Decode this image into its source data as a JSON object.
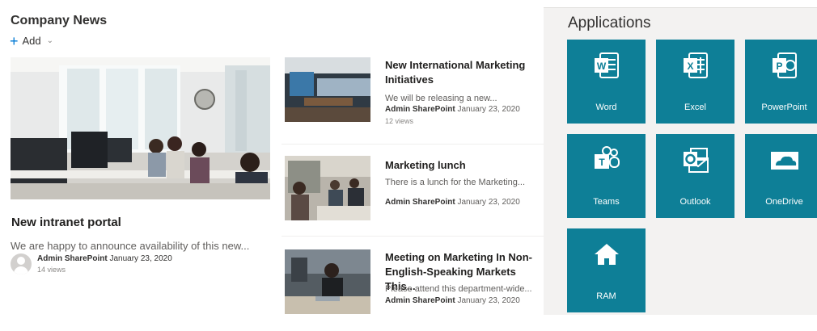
{
  "news": {
    "title": "Company News",
    "add_label": "Add",
    "hero": {
      "title": "New intranet portal",
      "description": "We are happy to announce availability of this new...",
      "author": "Admin SharePoint",
      "date": "January 23, 2020",
      "views": "14 views"
    },
    "items": [
      {
        "title": "New International Marketing Initiatives",
        "description": "We will be releasing a new...",
        "author": "Admin SharePoint",
        "date": "January 23, 2020",
        "views": "12 views"
      },
      {
        "title": "Marketing lunch",
        "description": "There is a lunch for the Marketing...",
        "author": "Admin SharePoint",
        "date": "January 23, 2020"
      },
      {
        "title": "Meeting on Marketing In Non-English-Speaking Markets This...",
        "description": "Please attend this department-wide...",
        "author": "Admin SharePoint",
        "date": "January 23, 2020"
      }
    ]
  },
  "apps": {
    "title": "Applications",
    "tiles": [
      {
        "label": "Word",
        "icon": "word-icon"
      },
      {
        "label": "Excel",
        "icon": "excel-icon"
      },
      {
        "label": "PowerPoint",
        "icon": "powerpoint-icon"
      },
      {
        "label": "Teams",
        "icon": "teams-icon"
      },
      {
        "label": "Outlook",
        "icon": "outlook-icon"
      },
      {
        "label": "OneDrive",
        "icon": "onedrive-icon"
      },
      {
        "label": "RAM",
        "icon": "home-icon"
      }
    ]
  },
  "colors": {
    "tile_background": "#0e7f97",
    "apps_background": "#f3f2f1",
    "accent": "#0078d4"
  }
}
